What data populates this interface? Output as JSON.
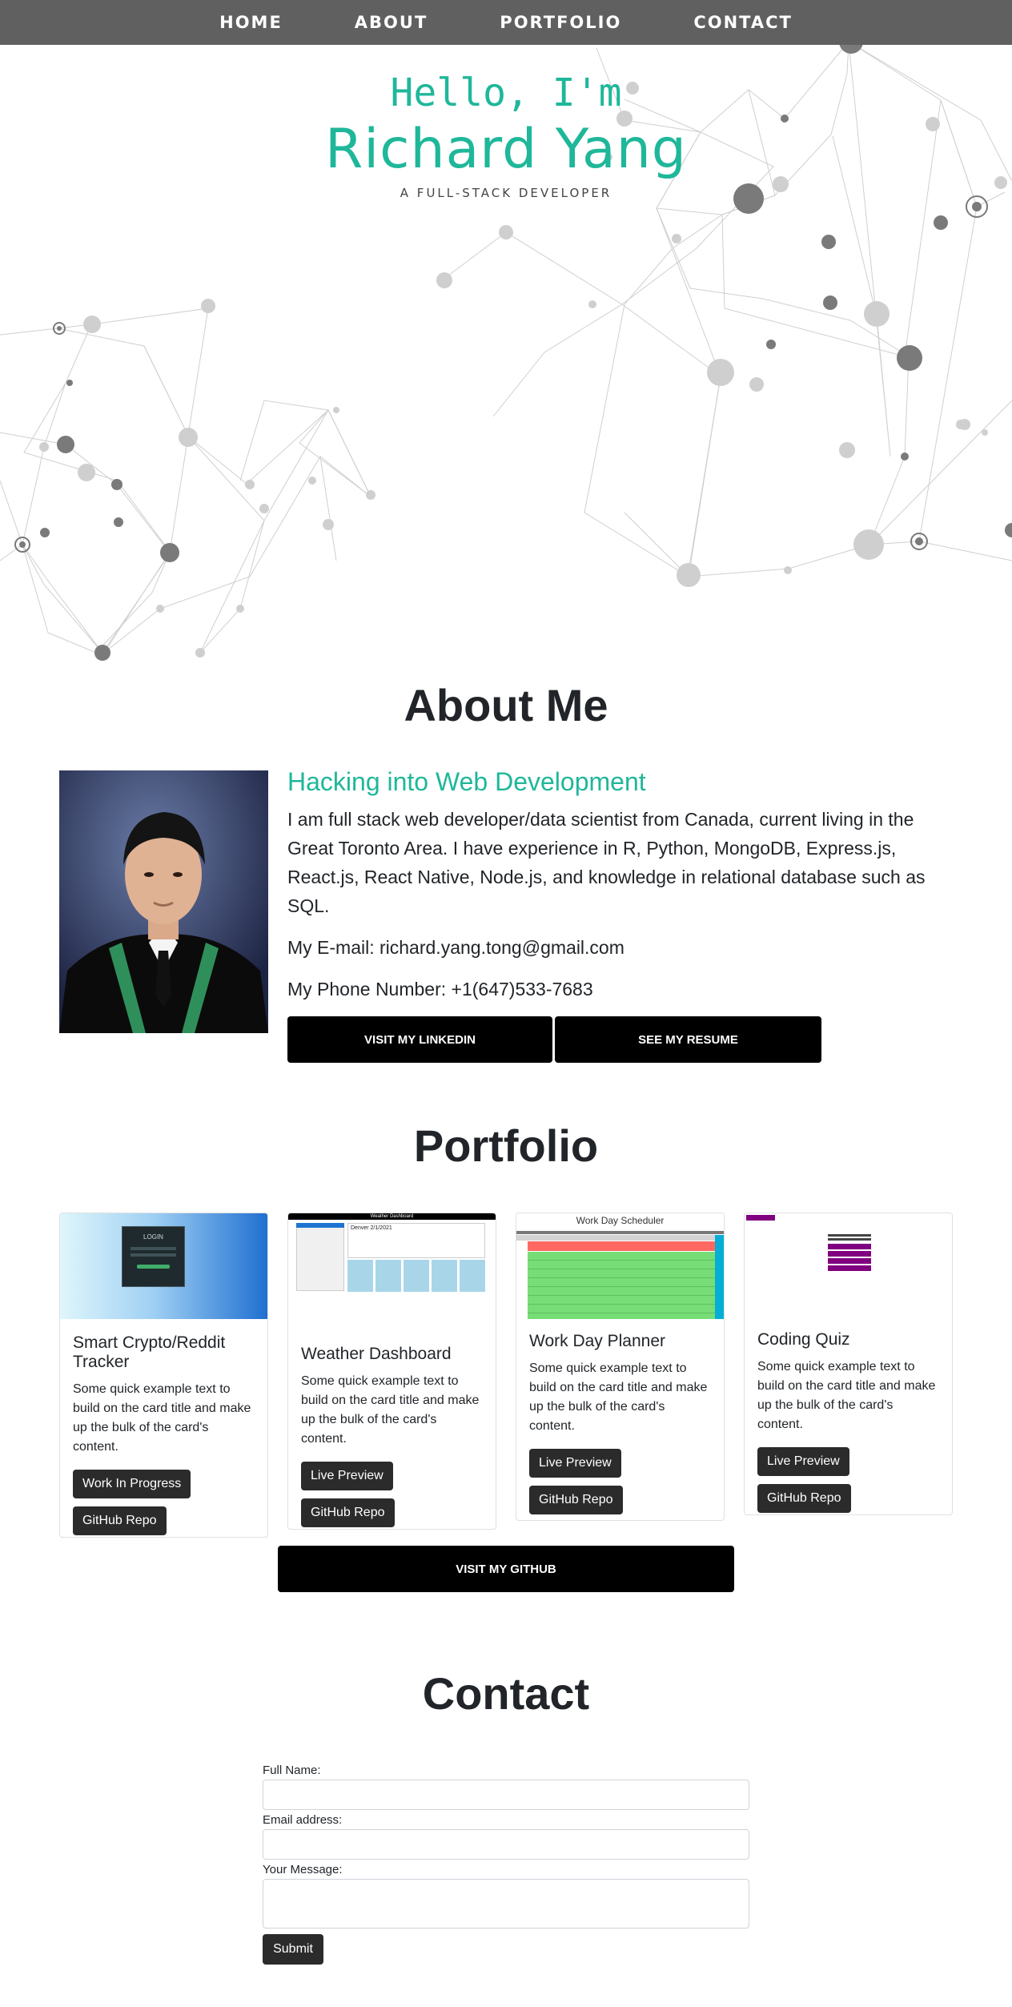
{
  "nav": {
    "items": [
      {
        "label": "HOME"
      },
      {
        "label": "ABOUT"
      },
      {
        "label": "PORTFOLIO"
      },
      {
        "label": "CONTACT"
      }
    ]
  },
  "hero": {
    "hello": "Hello, I'm",
    "name": "Richard Yang",
    "tagline": "A FULL-STACK DEVELOPER"
  },
  "about": {
    "title": "About Me",
    "heading": "Hacking into Web Development",
    "bio": "I am full stack web developer/data scientist from Canada, current living in the Great Toronto Area. I have experience in R, Python, MongoDB, Express.js, React.js, React Native, Node.js, and knowledge in relational database such as SQL.",
    "email": "My E-mail: richard.yang.tong@gmail.com",
    "phone": "My Phone Number: +1(647)533-7683",
    "linkedin_label": "VISIT MY LINKEDIN",
    "resume_label": "SEE MY RESUME"
  },
  "portfolio": {
    "title": "Portfolio",
    "cards": [
      {
        "title": "Smart Crypto/Reddit Tracker",
        "text": "Some quick example text to build on the card title and make up the bulk of the card's content.",
        "button1": "Work In Progress",
        "button2": "GitHub Repo",
        "thumb": {
          "login": "LOGIN"
        }
      },
      {
        "title": "Weather Dashboard",
        "text": "Some quick example text to build on the card title and make up the bulk of the card's content.",
        "button1": "Live Preview",
        "button2": "GitHub Repo",
        "thumb": {
          "header": "Weather Dashboard",
          "city": "Denver 2/1/2021"
        }
      },
      {
        "title": "Work Day Planner",
        "text": "Some quick example text to build on the card title and make up the bulk of the card's content.",
        "button1": "Live Preview",
        "button2": "GitHub Repo",
        "thumb": {
          "header": "Work Day Scheduler"
        }
      },
      {
        "title": "Coding Quiz",
        "text": "Some quick example text to build on the card title and make up the bulk of the card's content.",
        "button1": "Live Preview",
        "button2": "GitHub Repo",
        "thumb": {}
      }
    ],
    "github_label": "VISIT MY GITHUB"
  },
  "contact": {
    "title": "Contact",
    "name_label": "Full Name:",
    "email_label": "Email address:",
    "message_label": "Your Message:",
    "submit_label": "Submit"
  },
  "colors": {
    "accent": "#1fb79a",
    "nav_bg": "#606060",
    "button_black": "#000000",
    "button_dark": "#2b2b2b"
  }
}
